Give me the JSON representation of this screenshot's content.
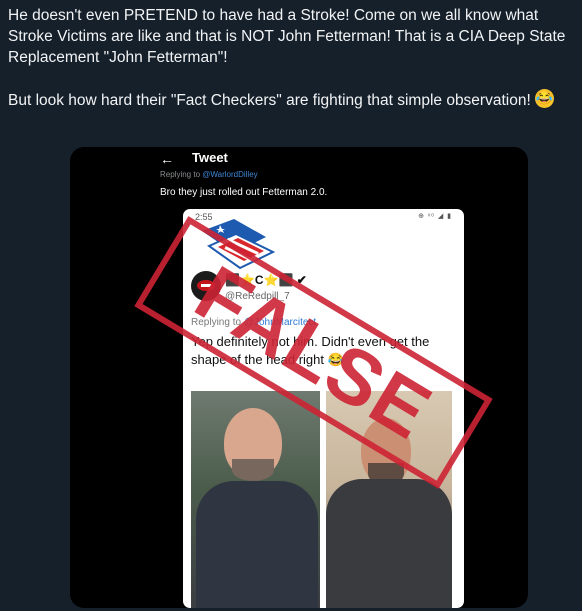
{
  "post": {
    "paragraph1": "He doesn't even PRETEND to have had a Stroke!  Come on we all know what Stroke Victims are like and that is NOT John Fetterman!  That is a CIA Deep State Replacement \"John Fetterman\"!",
    "paragraph2": "But look how hard their \"Fact Checkers\"  are fighting that simple observation!",
    "emoji": "rolling-on-floor-laughing-emoji"
  },
  "embedded_screenshot": {
    "header_title": "Tweet",
    "replying_prefix": "Replying to",
    "replying_handle": "@WarlordDilley",
    "tweet_text": "Bro they just rolled out Fetterman 2.0.",
    "phone": {
      "status_time": "2:55",
      "status_icons": "⊕ ᵛᵒ ◢ ▮",
      "display_name": "⬛⭐C⭐⬛ ✔",
      "user_handle": "@ReRedpill_7",
      "replying_prefix": "Replying to",
      "replying_handle": "@JohnMarcitect",
      "reply_text": "Yep definitely not him. Didn't even get the shape of the head right 😂"
    }
  },
  "overlay": {
    "stamp_text": "FALSE",
    "stamp_color": "#cd2334",
    "logo_colors": [
      "#1d5ab0",
      "#d9272e",
      "#ffffff"
    ]
  }
}
